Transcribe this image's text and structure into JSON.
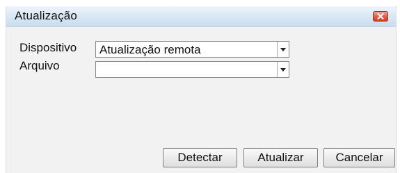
{
  "dialog": {
    "title": "Atualização",
    "close_icon": "close-icon"
  },
  "form": {
    "dispositivo": {
      "label": "Dispositivo",
      "value": "Atualização remota"
    },
    "arquivo": {
      "label": "Arquivo",
      "value": ""
    }
  },
  "buttons": {
    "detect": "Detectar",
    "update": "Atualizar",
    "cancel": "Cancelar"
  },
  "colors": {
    "titlebar": "#dbe9f5",
    "close_button": "#e0634b",
    "dialog_background": "#f2f2f2"
  }
}
